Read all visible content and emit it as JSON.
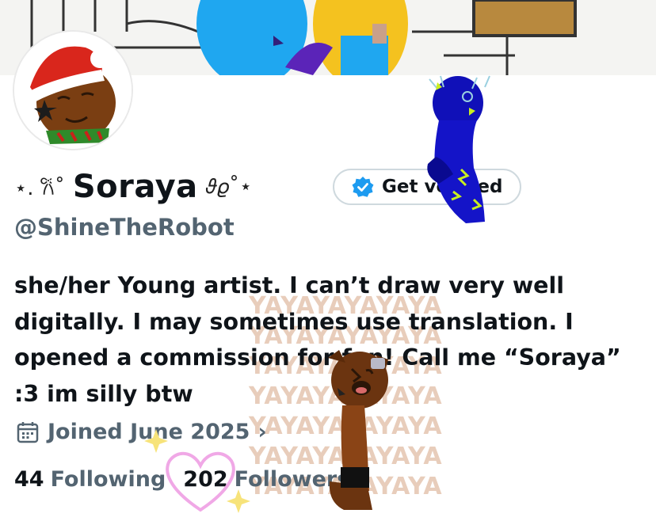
{
  "banner": {
    "alt": ""
  },
  "profile": {
    "deco_left": "⋆. 𐙚˚",
    "display_name": "Soraya",
    "deco_right": "𝜗𝜚˚⋆",
    "get_verified_label": "Get verified",
    "handle": "@ShineTheRobot",
    "bio_lines": [
      "she/her Young artist. I can’t draw very well",
      "digitally. I may sometimes use translation. I",
      "opened a commission for fun! Call me “Soraya”",
      ":3 im silly btw"
    ],
    "joined": "Joined June 2025",
    "following_count": "44",
    "following_label": "Following",
    "followers_count": "202",
    "followers_label": "Followers"
  },
  "watermark_lines": [
    "YAYAYAYAYAYA",
    "YAYAYAYAYAYA",
    "YAYAYAYAYAYA",
    "YAYAYAYAYAYA",
    "YAYAYAYAYAYA",
    "YAYAYAYAYAYA",
    "YAYAYAYAYAYA"
  ],
  "colors": {
    "accent": "#1d9bf0",
    "text": "#0f1419",
    "secondary": "#536471",
    "watermark": "#e8cdbb"
  },
  "icons": [
    "verified-badge-icon",
    "calendar-icon",
    "chevron-right-icon"
  ]
}
